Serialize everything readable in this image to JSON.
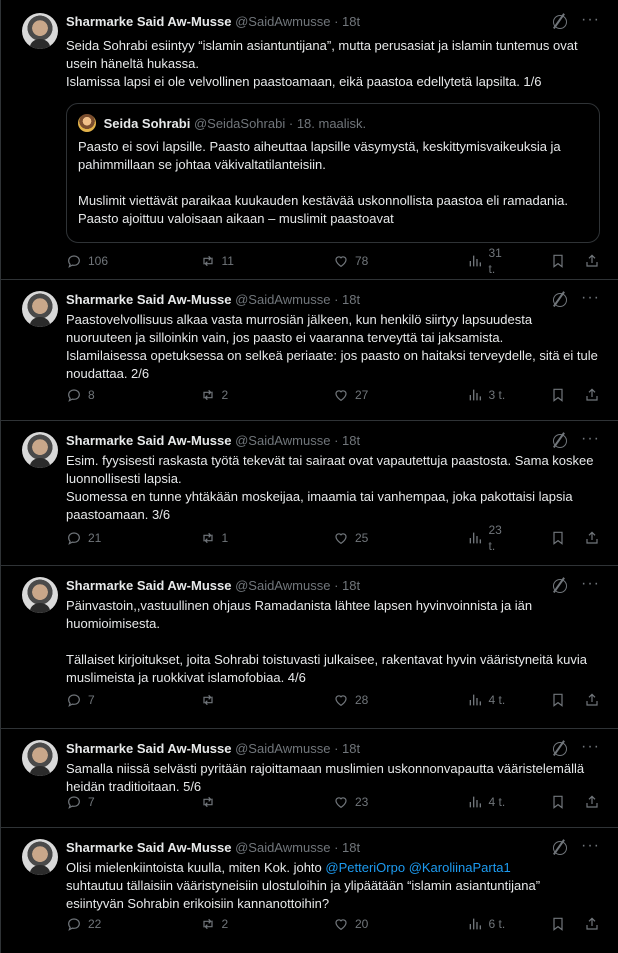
{
  "tweets": [
    {
      "name": "Sharmarke Said Aw-Musse",
      "handle": "@SaidAwmusse",
      "time": "18t",
      "text": "Seida Sohrabi esiintyy “islamin asiantuntijana”, mutta perusasiat ja islamin tuntemus ovat usein häneltä hukassa.\nIslamissa lapsi ei ole velvollinen paastoamaan, eikä paastoa edellytetä lapsilta. 1/6",
      "quote": {
        "name": "Seida Sohrabi",
        "handle": "@SeidaSohrabi",
        "time": "18. maalisk.",
        "text": "Paasto ei sovi lapsille. Paasto aiheuttaa lapsille väsymystä, keskittymisvaikeuksia ja pahimmillaan se johtaa väkivaltatilanteisiin.\n\nMuslimit viettävät paraikaa kuukauden kestävää uskonnollista paastoa eli ramadania. Paasto ajoittuu valoisaan aikaan – muslimit paastoavat"
      },
      "replies": "106",
      "reposts": "11",
      "likes": "78",
      "views": "31 t."
    },
    {
      "name": "Sharmarke Said Aw-Musse",
      "handle": "@SaidAwmusse",
      "time": "18t",
      "text": "Paastovelvollisuus alkaa vasta murrosiän jälkeen, kun henkilö siirtyy lapsuudesta nuoruuteen ja silloinkin vain, jos paasto ei vaaranna terveyttä tai jaksamista.\nIslamilaisessa opetuksessa on selkeä periaate: jos paasto on haitaksi terveydelle, sitä ei tule noudattaa. 2/6",
      "replies": "8",
      "reposts": "2",
      "likes": "27",
      "views": "3 t."
    },
    {
      "name": "Sharmarke Said Aw-Musse",
      "handle": "@SaidAwmusse",
      "time": "18t",
      "text": "Esim. fyysisesti raskasta työtä tekevät tai sairaat ovat vapautettuja paastosta. Sama koskee luonnollisesti lapsia.\nSuomessa en tunne yhtäkään moskeijaa, imaamia tai vanhempaa, joka pakottaisi lapsia paastoamaan. 3/6",
      "replies": "21",
      "reposts": "1",
      "likes": "25",
      "views": "23 t."
    },
    {
      "name": "Sharmarke Said Aw-Musse",
      "handle": "@SaidAwmusse",
      "time": "18t",
      "text": "Päinvastoin,,vastuullinen ohjaus Ramadanista lähtee lapsen hyvinvoinnista ja iän huomioimisesta.\n\nTällaiset kirjoitukset, joita Sohrabi toistuvasti julkaisee, rakentavat hyvin vääristyneitä kuvia muslimeista ja ruokkivat islamofobiaa. 4/6",
      "replies": "7",
      "reposts": "",
      "likes": "28",
      "views": "4 t."
    },
    {
      "name": "Sharmarke Said Aw-Musse",
      "handle": "@SaidAwmusse",
      "time": "18t",
      "text": "Samalla niissä selvästi pyritään rajoittamaan muslimien uskonnonvapautta vääristelemällä heidän traditioitaan. 5/6",
      "replies": "7",
      "reposts": "",
      "likes": "23",
      "views": "4 t."
    },
    {
      "name": "Sharmarke Said Aw-Musse",
      "handle": "@SaidAwmusse",
      "time": "18t",
      "text_before": "Olisi mielenkiintoista kuulla, miten Kok. johto ",
      "mention1": "@PetteriOrpo",
      "text_mid": " ",
      "mention2": "@KaroliinaParta1",
      "text_after": "\nsuhtautuu tällaisiin vääristyneisiin ulostuloihin ja ylipäätään “islamin asiantuntijana” esiintyvän Sohrabin erikoisiin kannanottoihin?",
      "replies": "22",
      "reposts": "2",
      "likes": "20",
      "views": "6 t."
    }
  ],
  "separator": "·",
  "more_glyph": "···",
  "icons": {
    "reply": "reply-icon",
    "repost": "repost-icon",
    "like": "heart-icon",
    "views": "views-icon",
    "bookmark": "bookmark-icon",
    "share": "share-icon",
    "grok": "grok-icon",
    "more": "more-icon"
  },
  "colors": {
    "background": "#000000",
    "text": "#e7e9ea",
    "muted": "#71767b",
    "link": "#1d9bf0",
    "border": "#2f3336"
  }
}
